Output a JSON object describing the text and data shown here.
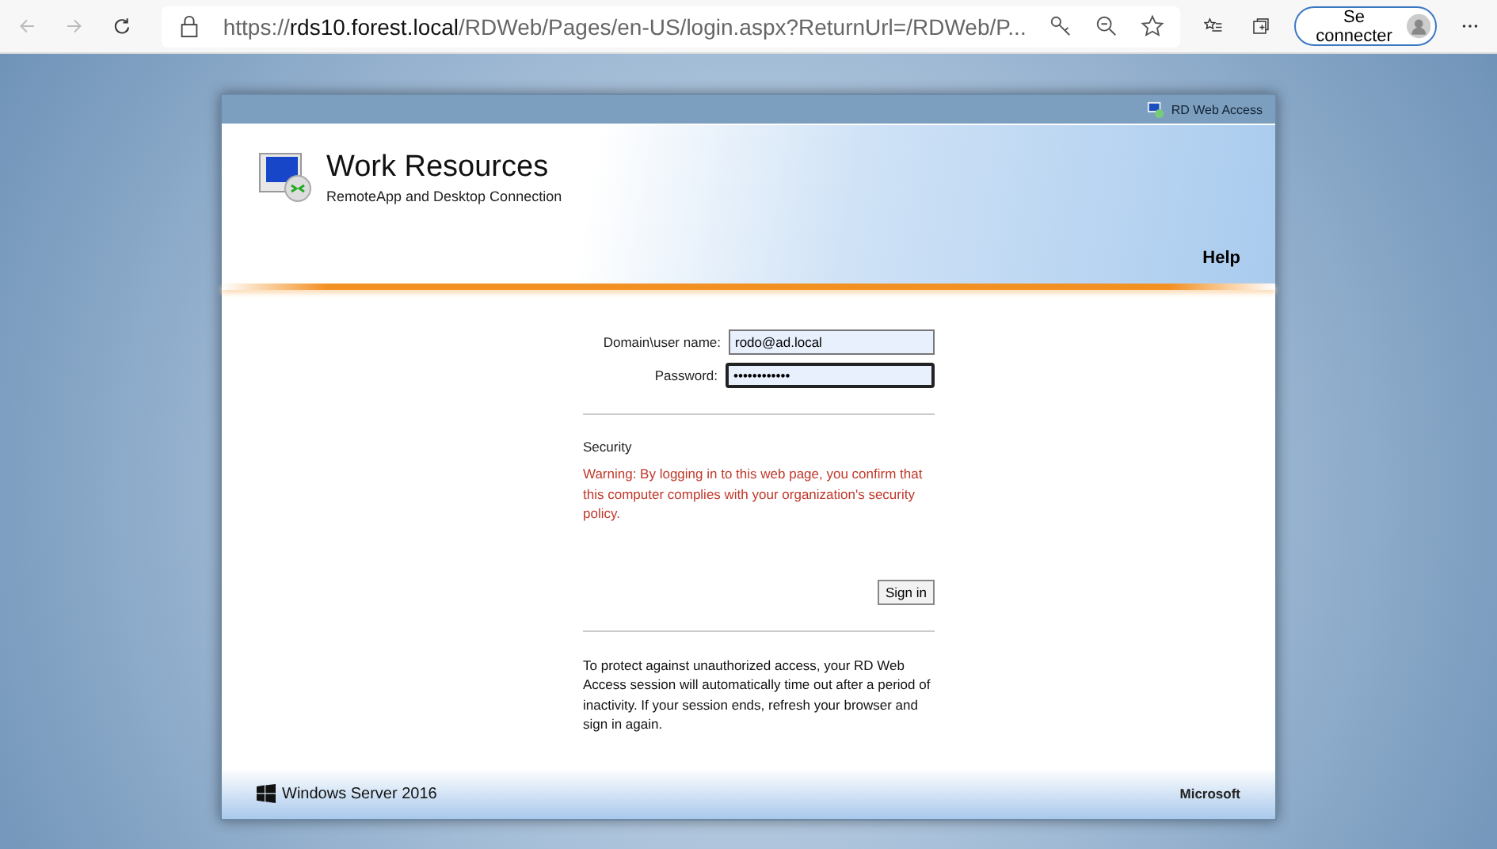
{
  "browser": {
    "url": {
      "scheme": "https://",
      "host": "rds10.forest.local",
      "path": "/RDWeb/Pages/en-US/login.aspx?ReturnUrl=/RDWeb/P..."
    },
    "profile_button": "Se connecter"
  },
  "page": {
    "top_bar": "RD Web Access",
    "title": "Work Resources",
    "subtitle": "RemoteApp and Desktop Connection",
    "help": "Help",
    "fields": [
      {
        "label": "Domain\\user name:",
        "value": "rodo@ad.local",
        "focused": false
      },
      {
        "label": "Password:",
        "value": "••••••••••••",
        "focused": true
      }
    ],
    "security_heading": "Security",
    "warning": "Warning: By logging in to this web page, you confirm that this computer complies with your organization's security policy.",
    "sign_in": "Sign in",
    "notice": "To protect against unauthorized access, your RD Web Access session will automatically time out after a period of inactivity. If your session ends, refresh your browser and sign in again.",
    "footer_left": "Windows Server 2016",
    "footer_right": "Microsoft"
  }
}
